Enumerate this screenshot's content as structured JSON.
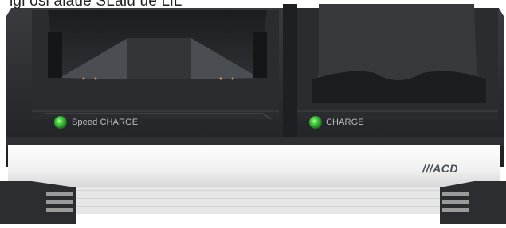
{
  "caption_fragment": "igi osl alaue SLalu ue LlL",
  "left_bay": {
    "indicator_label": "Speed CHARGE",
    "indicator_color": "#3fbf3a"
  },
  "right_bay": {
    "indicator_label": "CHARGE",
    "indicator_color": "#3fbf3a"
  },
  "brand": "///ACD",
  "colors": {
    "body": "#2b2d31",
    "front_panel": "#f4f4f4",
    "led": "#3fbf3a",
    "background": "#ffffff"
  },
  "icons": [
    "led-indicator-icon",
    "vent-slots-icon",
    "contact-pins-icon"
  ]
}
